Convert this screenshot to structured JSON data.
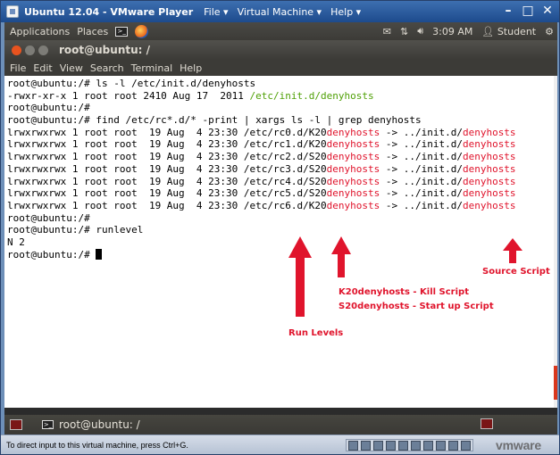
{
  "vmware": {
    "title": "Ubuntu 12.04 - VMware Player",
    "menus": [
      "File ▾",
      "Virtual Machine ▾",
      "Help ▾"
    ],
    "controls": [
      "–",
      "□",
      "✕"
    ],
    "status_hint": "To direct input to this virtual machine, press Ctrl+G.",
    "logo": "vmware"
  },
  "ubuntu_panel": {
    "applications": "Applications",
    "places": "Places",
    "time": "3:09 AM",
    "user": "Student"
  },
  "terminal": {
    "title": "root@ubuntu: /",
    "menu": [
      "File",
      "Edit",
      "View",
      "Search",
      "Terminal",
      "Help"
    ],
    "lines": {
      "l1": "root@ubuntu:/# ls -l /etc/init.d/denyhosts",
      "l2a": "-rwxr-xr-x 1 root root 2410 Aug 17  2011 ",
      "l2b": "/etc/init.d/denyhosts",
      "l3": "root@ubuntu:/#",
      "l4": "root@ubuntu:/# find /etc/rc*.d/* -print | xargs ls -l | grep denyhosts",
      "r0a": "lrwxrwxrwx 1 root root  19 Aug  4 23:30 /etc/rc0.d/K20",
      "r1a": "lrwxrwxrwx 1 root root  19 Aug  4 23:30 /etc/rc1.d/K20",
      "r2a": "lrwxrwxrwx 1 root root  19 Aug  4 23:30 /etc/rc2.d/S20",
      "r3a": "lrwxrwxrwx 1 root root  19 Aug  4 23:30 /etc/rc3.d/S20",
      "r4a": "lrwxrwxrwx 1 root root  19 Aug  4 23:30 /etc/rc4.d/S20",
      "r5a": "lrwxrwxrwx 1 root root  19 Aug  4 23:30 /etc/rc5.d/S20",
      "r6a": "lrwxrwxrwx 1 root root  19 Aug  4 23:30 /etc/rc6.d/K20",
      "rb": "denyhosts",
      "rc": " -> ../init.d/",
      "rd": "denyhosts",
      "l12": "root@ubuntu:/#",
      "l13": "root@ubuntu:/# runlevel",
      "l14": "N 2",
      "l15": "root@ubuntu:/# "
    }
  },
  "annotations": {
    "source_script": "Source Script",
    "kill_script": "K20denyhosts - Kill Script",
    "startup_script": "S20denyhosts - Start up Script",
    "run_levels": "Run Levels",
    "color": "#e0142c"
  },
  "taskbar": {
    "task_label": "root@ubuntu: /"
  }
}
